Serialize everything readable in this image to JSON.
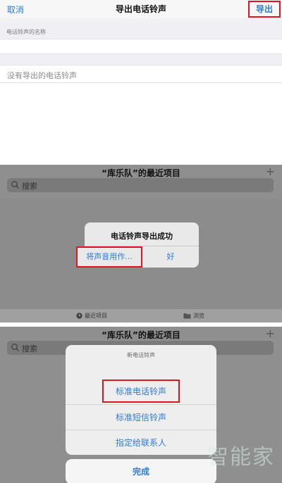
{
  "panel1": {
    "cancel": "取消",
    "title": "导出电话铃声",
    "export": "导出",
    "section_label": "电话铃声的名称",
    "empty_text": "没有导出的电话铃声"
  },
  "panel2": {
    "title": "“库乐队”的最近项目",
    "plus": "+",
    "search_placeholder": "搜索",
    "alert_title": "电话铃声导出成功",
    "use_sound_as": "将声音用作...",
    "ok": "好",
    "tab_recent": "最近项目",
    "tab_browse": "浏览"
  },
  "panel3": {
    "title": "“库乐队”的最近项目",
    "plus": "+",
    "search_placeholder": "搜索",
    "sheet_title": "新电话铃声",
    "option_standard_ringtone": "标准电话铃声",
    "option_standard_sms": "标准短信铃声",
    "option_assign_contact": "指定给联系人",
    "done": "完成",
    "watermark": "智能家"
  },
  "colors": {
    "accent": "#2f7ad8",
    "highlight": "#e0151d"
  }
}
